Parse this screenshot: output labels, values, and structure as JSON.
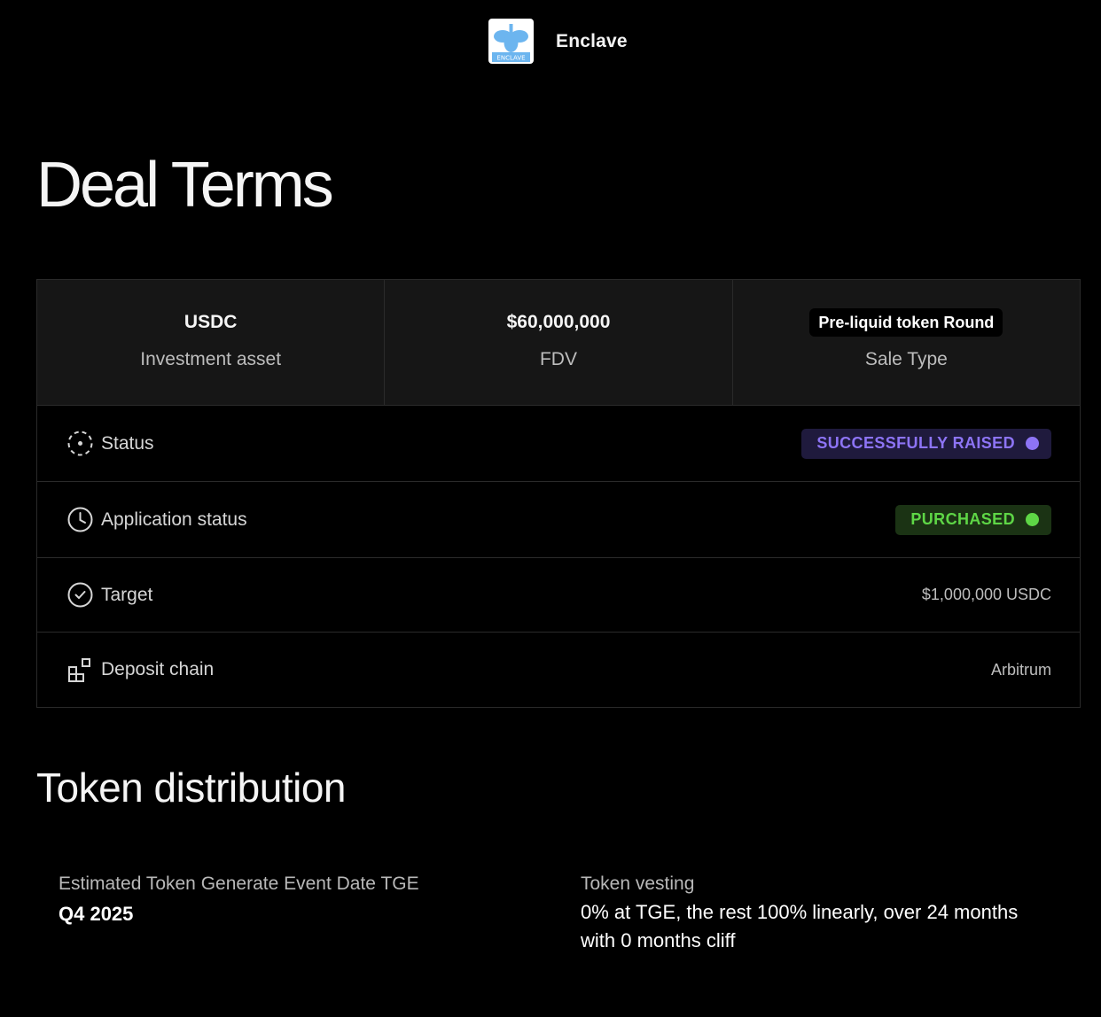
{
  "header": {
    "brand_name": "Enclave",
    "logo_text": "ENCLAVE"
  },
  "page_title": "Deal Terms",
  "summary": [
    {
      "value": "USDC",
      "label": "Investment asset"
    },
    {
      "value": "$60,000,000",
      "label": "FDV"
    },
    {
      "value": "Pre-liquid token Round",
      "label": "Sale Type"
    }
  ],
  "rows": {
    "status": {
      "label": "Status",
      "value": "SUCCESSFULLY RAISED",
      "color": "#8d74f5"
    },
    "application": {
      "label": "Application status",
      "value": "PURCHASED",
      "color": "#5ed646"
    },
    "target": {
      "label": "Target",
      "value": "$1,000,000 USDC"
    },
    "chain": {
      "label": "Deposit chain",
      "value": "Arbitrum"
    }
  },
  "distribution": {
    "title": "Token distribution",
    "tge_label": "Estimated Token Generate Event Date TGE",
    "tge_value": "Q4 2025",
    "vesting_label": "Token vesting",
    "vesting_value": "0% at TGE, the rest 100% linearly, over 24 months with 0 months cliff"
  }
}
